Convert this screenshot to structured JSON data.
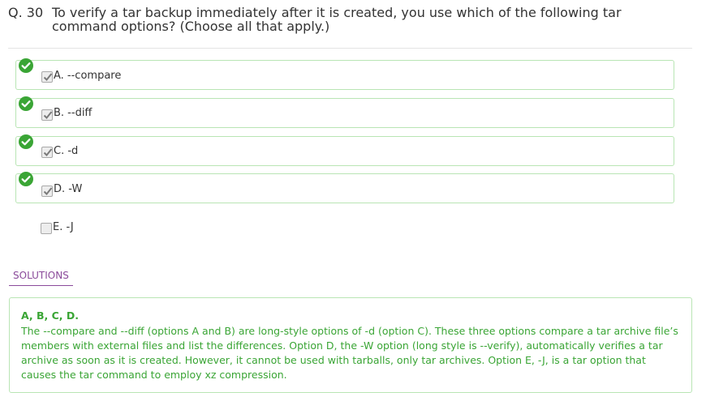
{
  "question": {
    "number": "Q. 30",
    "text": "To verify a tar backup immediately after it is created, you use which of the following tar command options? (Choose all that apply.)"
  },
  "options": [
    {
      "label": "A. --compare",
      "checked": true,
      "correct": true
    },
    {
      "label": "B. --diff",
      "checked": true,
      "correct": true
    },
    {
      "label": "C. -d",
      "checked": true,
      "correct": true
    },
    {
      "label": "D. -W",
      "checked": true,
      "correct": true
    },
    {
      "label": "E. -J",
      "checked": false,
      "correct": false
    }
  ],
  "solutions": {
    "tab_label": "SOLUTIONS",
    "answer": "A, B, C, D.",
    "explanation": "The --compare and --diff (options A and B) are long-style options of -d (option C). These three options compare a tar archive file’s members with external files and list the differences. Option D, the -W option (long style is --verify), automatically verifies a tar archive as soon as it is created. However, it cannot be used with tarballs, only tar archives. Option E, -J, is a tar option that causes the tar command to employ xz compression."
  },
  "colors": {
    "correct_green": "#3aa535",
    "border_green": "#b9e5b4",
    "solutions_purple": "#8a4a9a"
  },
  "icons": {
    "correct_marker": "check-circle-icon",
    "checkbox_mark": "checkmark-icon"
  }
}
